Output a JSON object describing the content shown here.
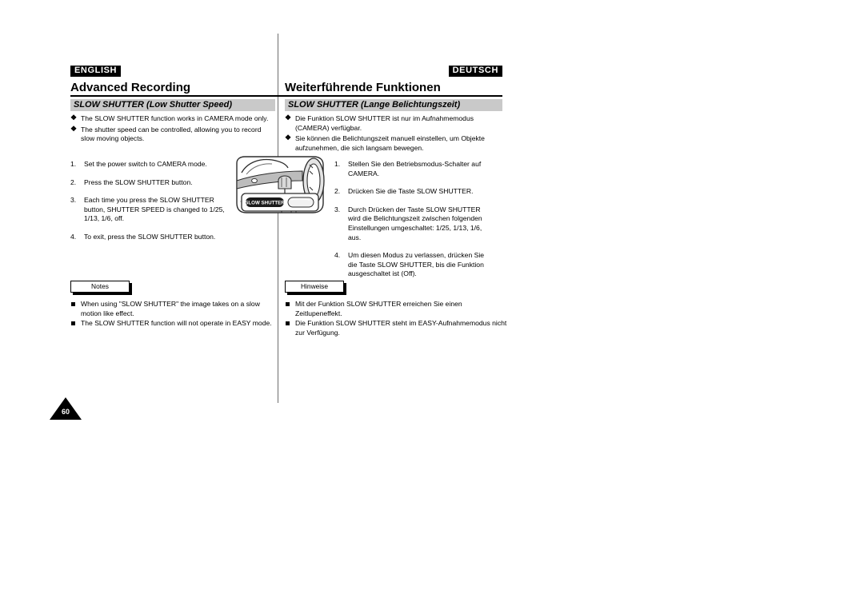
{
  "page": {
    "number": "60",
    "left_column": {
      "language_tag": "ENGLISH",
      "title": "Advanced Recording",
      "section_title": "SLOW SHUTTER (Low Shutter Speed)",
      "bullets": [
        "The SLOW SHUTTER function works in CAMERA mode only.",
        "The shutter speed can be controlled, allowing you to record slow moving objects."
      ],
      "steps": [
        {
          "num": "1.",
          "text": "Set the power switch to CAMERA mode."
        },
        {
          "num": "2.",
          "text": "Press the SLOW SHUTTER button."
        },
        {
          "num": "3.",
          "text": "Each time you press the SLOW SHUTTER button, SHUTTER SPEED is changed to 1/25, 1/13, 1/6, off."
        },
        {
          "num": "4.",
          "text": "To exit, press the SLOW SHUTTER button."
        }
      ],
      "notes_label": "Notes",
      "notes": [
        "When using \"SLOW SHUTTER\" the image takes on a slow motion like effect.",
        "The SLOW SHUTTER function will not operate in EASY mode."
      ]
    },
    "right_column": {
      "language_tag": "DEUTSCH",
      "title": "Weiterführende Funktionen",
      "section_title": "SLOW SHUTTER (Lange Belichtungszeit)",
      "bullets": [
        "Die Funktion SLOW SHUTTER ist nur im Aufnahmemodus (CAMERA) verfügbar.",
        "Sie können die Belichtungszeit manuell einstellen, um Objekte aufzunehmen, die sich langsam bewegen."
      ],
      "steps": [
        {
          "num": "1.",
          "text": "Stellen Sie den Betriebsmodus-Schalter auf CAMERA."
        },
        {
          "num": "2.",
          "text": "Drücken Sie die Taste SLOW SHUTTER."
        },
        {
          "num": "3.",
          "text": "Durch Drücken der Taste SLOW SHUTTER wird die Belichtungszeit zwischen folgenden Einstellungen umgeschaltet: 1/25, 1/13, 1/6, aus."
        },
        {
          "num": "4.",
          "text": "Um diesen Modus zu verlassen, drücken Sie die Taste SLOW SHUTTER, bis die Funktion ausgeschaltet ist (Off)."
        }
      ],
      "notes_label": "Hinweise",
      "notes": [
        "Mit der Funktion SLOW SHUTTER erreichen Sie einen Zeitlupeneffekt.",
        "Die Funktion SLOW SHUTTER steht im EASY-Aufnahmemodus nicht zur Verfügung."
      ]
    },
    "illustration": {
      "name": "camcorder-slow-shutter-button",
      "button_label": "SLOW SHUTTER"
    },
    "marks": {
      "bullet_glyph": "❖",
      "note_glyph": "■"
    },
    "colors": {
      "section_bar_bg": "#c9c9c9",
      "tag_bg": "#000000",
      "tag_fg": "#ffffff",
      "rule": "#000000",
      "divider": "#6e6e6e"
    }
  }
}
